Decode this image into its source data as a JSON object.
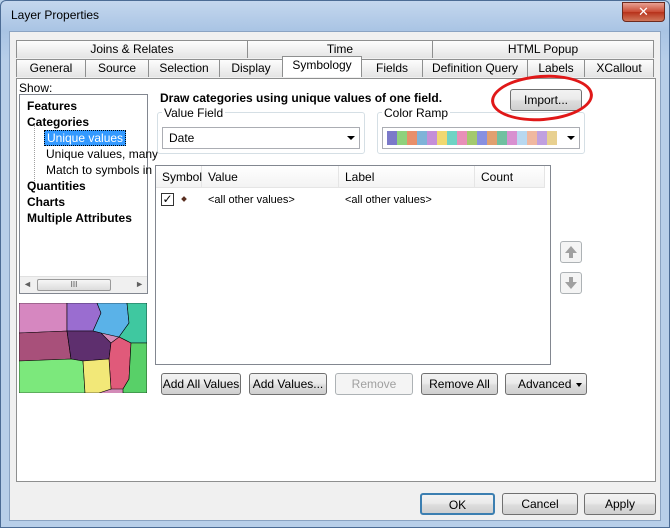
{
  "window": {
    "title": "Layer Properties",
    "close_glyph": "✕"
  },
  "tabs": {
    "row1": [
      {
        "label": "Joins & Relates"
      },
      {
        "label": "Time"
      },
      {
        "label": "HTML Popup"
      }
    ],
    "row2": [
      {
        "label": "General"
      },
      {
        "label": "Source"
      },
      {
        "label": "Selection"
      },
      {
        "label": "Display"
      },
      {
        "label": "Symbology"
      },
      {
        "label": "Fields"
      },
      {
        "label": "Definition Query"
      },
      {
        "label": "Labels"
      },
      {
        "label": "XCallout"
      }
    ],
    "active": "Symbology"
  },
  "show": {
    "label": "Show:",
    "items": [
      {
        "label": "Features",
        "bold": true
      },
      {
        "label": "Categories",
        "bold": true
      },
      {
        "label": "Unique values",
        "selected": true
      },
      {
        "label": "Unique values, many"
      },
      {
        "label": "Match to symbols in a"
      },
      {
        "label": "Quantities",
        "bold": true
      },
      {
        "label": "Charts",
        "bold": true
      },
      {
        "label": "Multiple Attributes",
        "bold": true
      }
    ],
    "scroll_left": "◄",
    "scroll_right": "►",
    "scroll_thumb": "III"
  },
  "symbology": {
    "heading": "Draw categories using unique values of one field.",
    "import_label": "Import...",
    "value_field_label": "Value Field",
    "value_field_value": "Date",
    "color_ramp_label": "Color Ramp",
    "color_ramp_colors": [
      "#7b79c9",
      "#8fd17c",
      "#e88f6a",
      "#7fb3d8",
      "#c58fd8",
      "#f0d870",
      "#6fd3c4",
      "#e88fb8",
      "#a3c96e",
      "#8890e0",
      "#e0a070",
      "#70c0a0",
      "#d890d0",
      "#b8d8f0",
      "#f0b8a0",
      "#c0a0e0",
      "#e8d090"
    ],
    "table_headers": {
      "symbol": "Symbol",
      "value": "Value",
      "label": "Label",
      "count": "Count"
    },
    "rows": [
      {
        "checked": true,
        "value": "<all other values>",
        "label": "<all other values>",
        "count": ""
      }
    ],
    "buttons": {
      "add_all": "Add All Values",
      "add_values": "Add Values...",
      "remove": "Remove",
      "remove_all": "Remove All",
      "advanced": "Advanced"
    }
  },
  "dialog_buttons": {
    "ok": "OK",
    "cancel": "Cancel",
    "apply": "Apply"
  },
  "colors": {
    "annotation_circle": "#e01818",
    "selection": "#3399ff"
  }
}
